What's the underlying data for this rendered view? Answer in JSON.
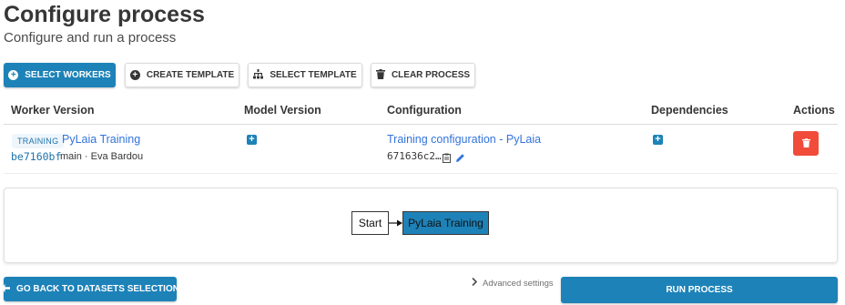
{
  "header": {
    "title": "Configure process",
    "subtitle": "Configure and run a process"
  },
  "toolbar": {
    "select_workers": "SELECT WORKERS",
    "create_template": "CREATE TEMPLATE",
    "select_template": "SELECT TEMPLATE",
    "clear_process": "CLEAR PROCESS"
  },
  "table": {
    "columns": [
      "Worker Version",
      "Model Version",
      "Configuration",
      "Dependencies",
      "Actions"
    ],
    "rows": [
      {
        "tag": "TRAINING",
        "worker_name": "PyLaia Training",
        "revision_hash": "be7160bf",
        "revision_info": "main · Eva Bardou",
        "configuration_name": "Training configuration - PyLaia",
        "configuration_id": "671636c2…"
      }
    ]
  },
  "graph": {
    "start_node": "Start",
    "worker_node": "PyLaia Training"
  },
  "footer": {
    "back_button": "GO BACK TO DATASETS SELECTION",
    "advanced_settings": "Advanced settings",
    "run_button": "RUN PROCESS"
  },
  "colors": {
    "primary": "#1d82b8",
    "danger": "#f14c3a",
    "link": "#3273dc"
  }
}
